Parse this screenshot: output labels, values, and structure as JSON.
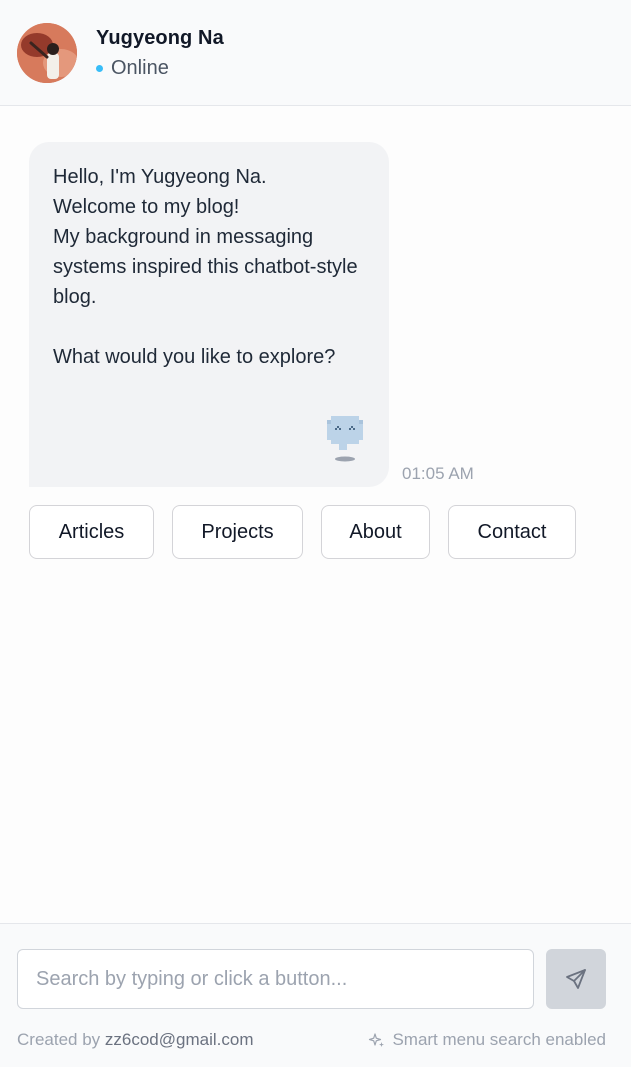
{
  "header": {
    "name": "Yugyeong Na",
    "status": "Online",
    "status_color": "#38bdf8"
  },
  "chat": {
    "message": {
      "text": "Hello, I'm Yugyeong Na.\nWelcome to my blog!\nMy background in messaging systems inspired this chatbot-style blog.\n\nWhat would you like to explore?",
      "timestamp": "01:05 AM",
      "mascot_icon": "chat-bubble-mascot-icon"
    },
    "quick_replies": [
      {
        "label": "Articles"
      },
      {
        "label": "Projects"
      },
      {
        "label": "About"
      },
      {
        "label": "Contact"
      }
    ]
  },
  "footer": {
    "search": {
      "placeholder": "Search by typing or click a button...",
      "value": ""
    },
    "send_icon": "send-icon",
    "created_by_label": "Created by ",
    "created_by_email": "zz6cod@gmail.com",
    "smart_menu_label": "Smart menu search enabled",
    "smart_menu_icon": "sparkle-icon"
  },
  "colors": {
    "bubble_bg": "#f2f3f5",
    "send_button_bg": "#d1d5db",
    "accent": "#38bdf8"
  }
}
